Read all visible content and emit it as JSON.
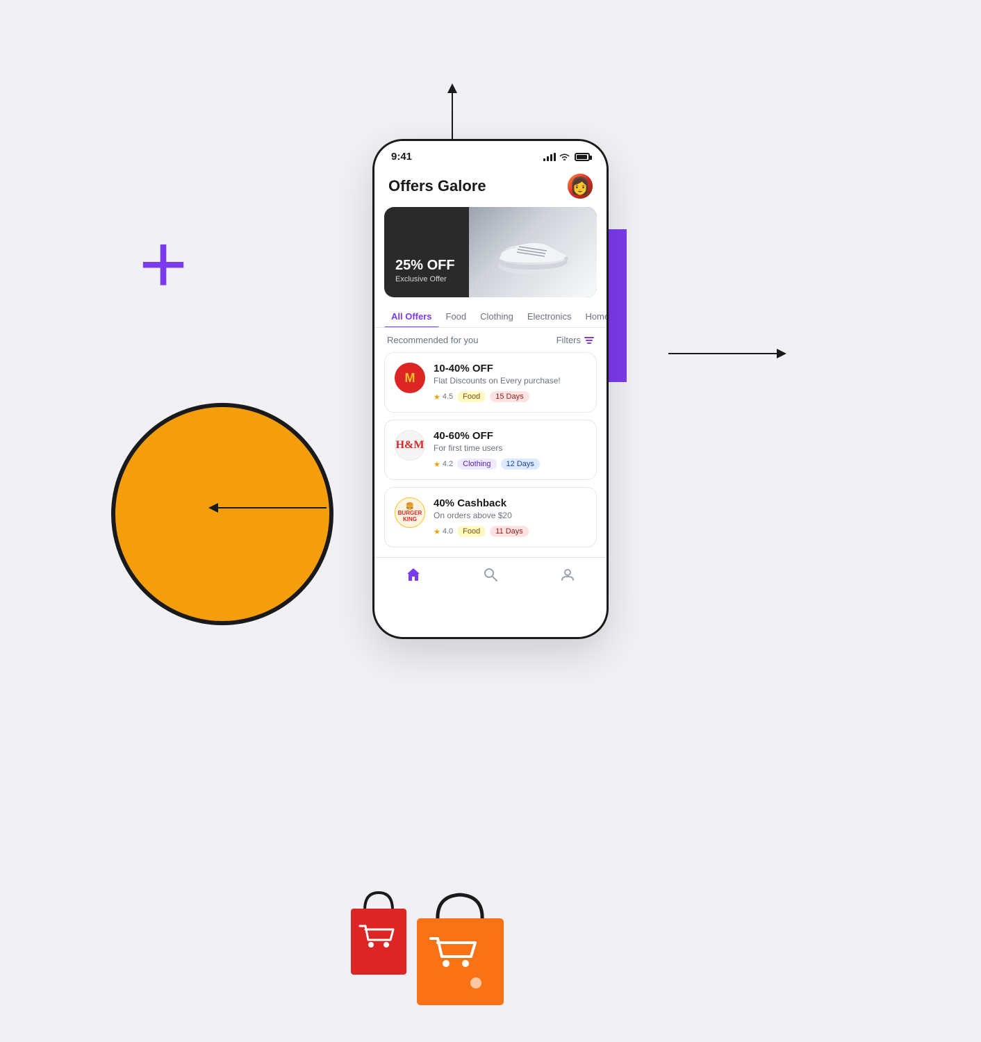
{
  "page": {
    "background": "#f0f0f5"
  },
  "decorative": {
    "plus_symbol": "+",
    "plus_color": "#7c3aed",
    "circle_color": "#f59e0b",
    "rect_color": "#7c3aed"
  },
  "phone": {
    "status_bar": {
      "time": "9:41",
      "signal": "signal",
      "wifi": "wifi",
      "battery": "battery"
    },
    "header": {
      "title": "Offers Galore",
      "avatar_alt": "user avatar"
    },
    "hero": {
      "discount": "25% OFF",
      "subtitle": "Exclusive Offer"
    },
    "tabs": [
      {
        "label": "All Offers",
        "active": true
      },
      {
        "label": "Food",
        "active": false
      },
      {
        "label": "Clothing",
        "active": false
      },
      {
        "label": "Electronics",
        "active": false
      },
      {
        "label": "Home",
        "active": false
      }
    ],
    "filter": {
      "recommended_label": "Recommended for you",
      "filter_label": "Filters"
    },
    "offers": [
      {
        "brand": "McDonald's",
        "brand_short": "M",
        "logo_style": "mcdonalds",
        "title": "10-40% OFF",
        "description": "Flat Discounts on Every purchase!",
        "rating": "4.5",
        "category": "Food",
        "days": "15 Days"
      },
      {
        "brand": "H&M",
        "brand_short": "H&M",
        "logo_style": "hm",
        "title": "40-60% OFF",
        "description": "For first time users",
        "rating": "4.2",
        "category": "Clothing",
        "days": "12 Days"
      },
      {
        "brand": "Burger King",
        "brand_short": "BK",
        "logo_style": "bk",
        "title": "40% Cashback",
        "description": "On orders above $20",
        "rating": "4.0",
        "category": "Food",
        "days": "11 Days"
      }
    ],
    "bottom_nav": {
      "home": "🏠",
      "search": "🔍",
      "profile": "👤"
    }
  }
}
